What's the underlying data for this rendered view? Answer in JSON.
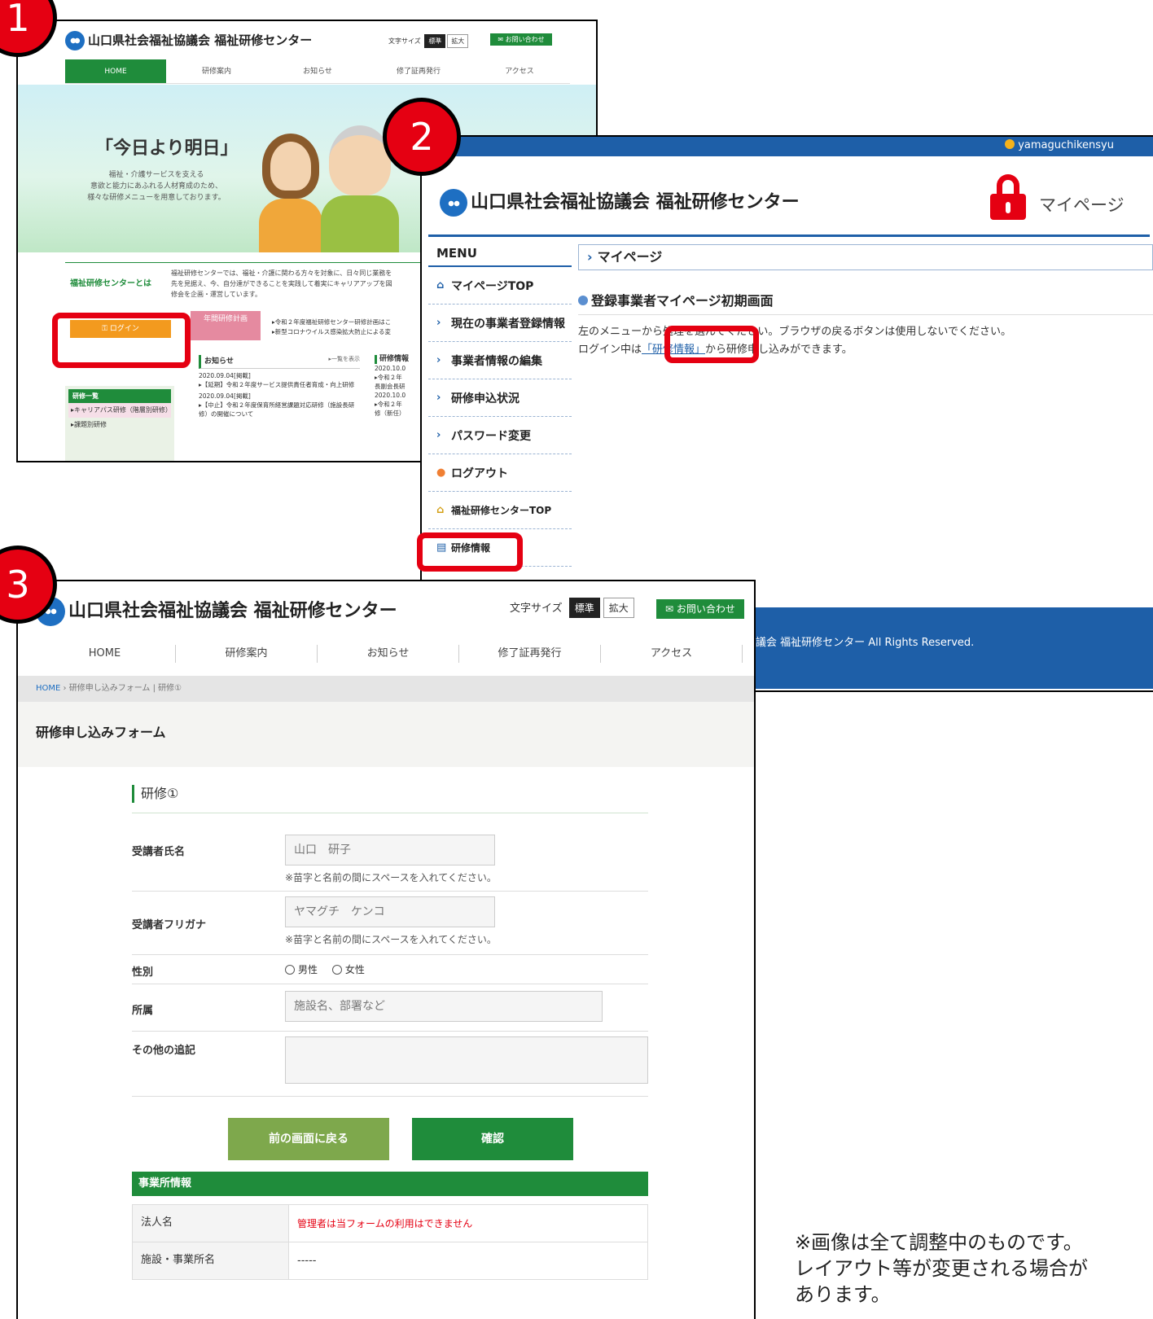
{
  "badges": [
    "1",
    "2",
    "3"
  ],
  "screen1": {
    "brand": "山口県社会福祉協議会 福祉研修センター",
    "font_size_label": "文字サイズ",
    "font_size_options": [
      "標準",
      "拡大"
    ],
    "contact": "お問い合わせ",
    "nav": [
      "HOME",
      "研修案内",
      "お知らせ",
      "修了証再発行",
      "アクセス"
    ],
    "slogan": "「今日より明日」",
    "slogan_sub": "福祉・介護サービスを支える\n意欲と能力にあふれる人材育成のため、\n様々な研修メニューを用意しております。",
    "about_title": "福祉研修センターとは",
    "about_text": "福祉研修センターでは、福祉・介護に関わる方々を対象に、日々同じ業務を\n先を見据え、今、自分達ができることを実践して着実にキャリアアップを図\n修会を企画・運営しています。",
    "login_label": "ログイン",
    "annual_plan": "年間研修計画",
    "annual_links": "▸令和２年度福祉研修センター研修計画はこ\n▸新型コロナウイルス感染拡大防止による変",
    "news_title": "お知らせ",
    "news_more": "▸一覧を表示",
    "news_items": [
      {
        "date": "2020.09.04[掲載]",
        "text": "▸【延期】令和２年度サービス提供責任者育成・向上研修"
      },
      {
        "date": "2020.09.04[掲載]",
        "text": "▸【中止】令和２年度保育所経営課題対応研修（施設長研修）の開催について"
      }
    ],
    "col2_title": "研修情報",
    "col2_items": [
      "2020.10.0",
      "▸令和２年",
      "長副会長研",
      "2020.10.0",
      "▸令和２年",
      "修（新任）"
    ],
    "training_title": "研修一覧",
    "training_items": [
      "▸キャリアパス研修（階層別研修）",
      "▸課題別研修"
    ]
  },
  "screen2": {
    "username": "yamaguchikensyu",
    "brand": "山口県社会福祉協議会 福祉研修センター",
    "mypage_title": "マイページ",
    "menu_header": "MENU",
    "menu_items": [
      {
        "icon": "home-icon",
        "label": "マイページTOP"
      },
      {
        "icon": "chevron-right-icon",
        "label": "現在の事業者登録情報"
      },
      {
        "icon": "chevron-right-icon",
        "label": "事業者情報の編集"
      },
      {
        "icon": "chevron-right-icon",
        "label": "研修申込状況"
      },
      {
        "icon": "chevron-right-icon",
        "label": "パスワード変更"
      },
      {
        "icon": "logout-icon",
        "label": "ログアウト"
      },
      {
        "icon": "home-icon",
        "label": "福祉研修センターTOP"
      },
      {
        "icon": "calendar-icon",
        "label": "研修情報"
      }
    ],
    "page_heading": "マイページ",
    "section_title": "登録事業者マイページ初期画面",
    "text_line1": "左のメニューから処理を選んでください。ブラウザの戻るボタンは使用しないでください。",
    "text_line2_prefix": "ログイン中は",
    "text_link": "「研修情報」",
    "text_line2_suffix": "から研修申し込みができます。",
    "footer": "議会 福祉研修センター All Rights Reserved."
  },
  "screen3": {
    "brand": "山口県社会福祉協議会 福祉研修センター",
    "font_size_label": "文字サイズ",
    "font_size_options": [
      "標準",
      "拡大"
    ],
    "contact": "お問い合わせ",
    "nav": [
      "HOME",
      "研修案内",
      "お知らせ",
      "修了証再発行",
      "アクセス"
    ],
    "breadcrumb_home": "HOME",
    "breadcrumb_current": "研修申し込みフォーム | 研修①",
    "page_title": "研修申し込みフォーム",
    "section": "研修①",
    "fields": {
      "name_label": "受講者氏名",
      "name_placeholder": "山口　研子",
      "name_note": "※苗字と名前の間にスペースを入れてください。",
      "kana_label": "受講者フリガナ",
      "kana_placeholder": "ヤマグチ　ケンコ",
      "kana_note": "※苗字と名前の間にスペースを入れてください。",
      "gender_label": "性別",
      "gender_options": [
        "男性",
        "女性"
      ],
      "affiliation_label": "所属",
      "affiliation_placeholder": "施設名、部署など",
      "other_label": "その他の追記"
    },
    "back_button": "前の画面に戻る",
    "confirm_button": "確認",
    "business_header": "事業所情報",
    "business_rows": [
      {
        "key": "法人名",
        "value": "管理者は当フォームの利用はできません"
      },
      {
        "key": "施設・事業所名",
        "value": "-----"
      }
    ]
  },
  "note": "※画像は全て調整中のものです。\nレイアウト等が変更される場合が\nあります。"
}
